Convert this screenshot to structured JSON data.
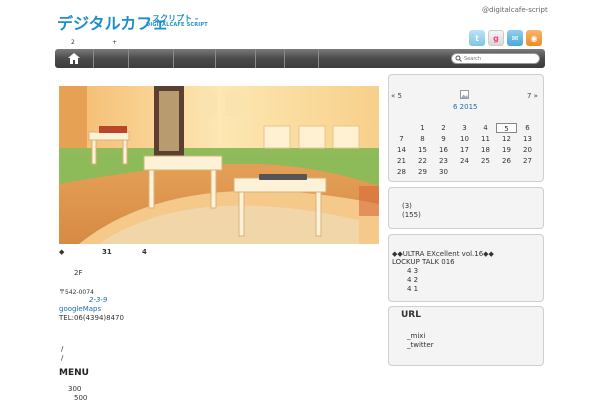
{
  "header": {
    "logo_main": "デジタルカフェ",
    "logo_sub1": "- スクリプト -",
    "logo_sub2": "DIGITALCAFE SCRIPT",
    "twitter_handle": "@digitalcafe-script",
    "top_numbers": [
      "2",
      "+"
    ]
  },
  "social_icons": [
    {
      "icon": "twitter-icon",
      "glyph": "t"
    },
    {
      "icon": "google-friend-icon",
      "glyph": "g"
    },
    {
      "icon": "mail-icon",
      "glyph": "✉"
    },
    {
      "icon": "rss-icon",
      "glyph": "◉"
    }
  ],
  "nav": {
    "home_icon": "home-icon",
    "search_placeholder": "Search"
  },
  "content": {
    "line1_a": "◆",
    "line1_b": "31",
    "line1_c": "4",
    "floor": "2F",
    "postal": "〒542-0074",
    "address_link": "2-3-9",
    "maps_link": "googleMaps",
    "tel": "TEL:06(4394)8470",
    "slash1": "/",
    "slash2": "/",
    "menu_head": "MENU",
    "price1": "300",
    "price2": "500"
  },
  "calendar": {
    "prev": "« 5",
    "next": "7 »",
    "month_label": "6  2015",
    "days": [
      "1",
      "2",
      "3",
      "4",
      "5",
      "6",
      "7",
      "8",
      "9",
      "10",
      "11",
      "12",
      "13",
      "14",
      "15",
      "16",
      "17",
      "18",
      "19",
      "20",
      "21",
      "22",
      "23",
      "24",
      "25",
      "26",
      "27",
      "28",
      "29",
      "30"
    ],
    "today": "5"
  },
  "archive": {
    "item1": "(3)",
    "item2": "(155)"
  },
  "news": {
    "title1": "◆◆ULTRA EXcellent vol.16◆◆",
    "title2": "LOCKUP TALK 016",
    "sub1": "4   3",
    "sub2": "4   2",
    "sub3": "4   1"
  },
  "url_widget": {
    "heading": "URL",
    "link1": "_mixi",
    "link2": "_twitter"
  },
  "colors": {
    "brand": "#1e90c8",
    "nav_dark": "#3c3c3c",
    "link": "#1a6fb0"
  }
}
